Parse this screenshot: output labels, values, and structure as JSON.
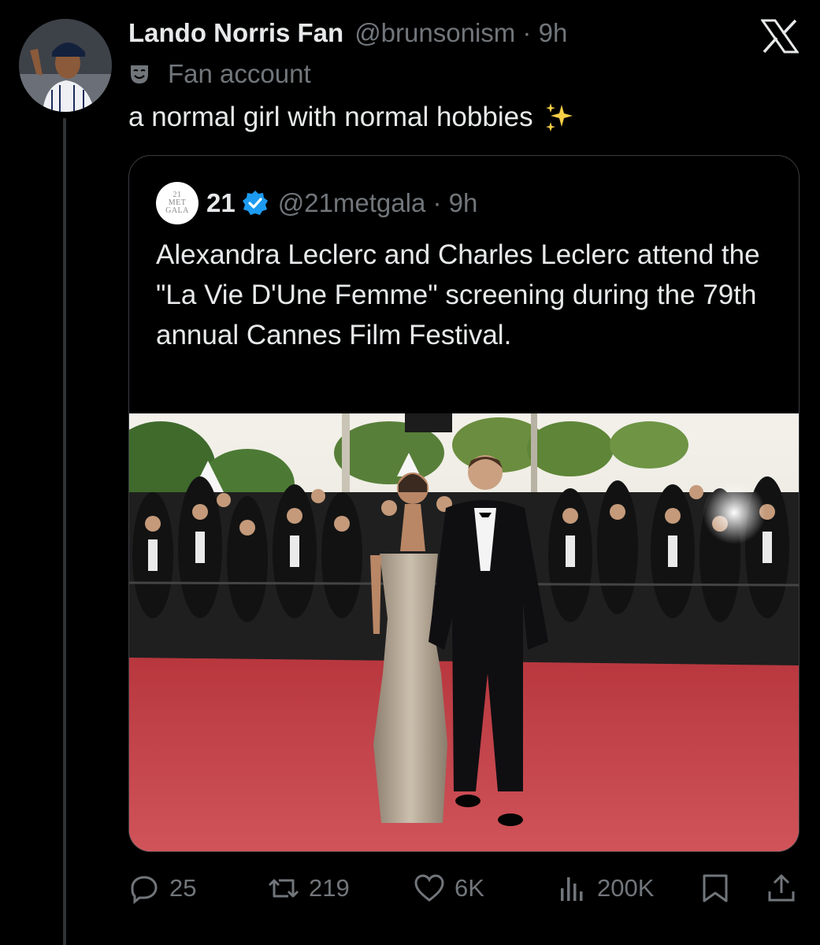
{
  "tweet": {
    "display_name": "Lando Norris Fan",
    "handle": "@brunsonism",
    "time": "9h",
    "label": "Fan account",
    "text": "a normal girl with normal hobbies"
  },
  "quoted": {
    "avatar_lines": [
      "21",
      "MET",
      "GALA"
    ],
    "display_name": "21",
    "handle": "@21metgala",
    "time": "9h",
    "text": "Alexandra Leclerc and Charles Leclerc attend the \"La Vie D'Une Femme\" screening during the 79th annual Cannes Film Festival."
  },
  "actions": {
    "replies": "25",
    "reposts": "219",
    "likes": "6K",
    "views": "200K"
  },
  "colors": {
    "background": "#000000",
    "text_primary": "#e7e9ea",
    "text_secondary": "#71767b",
    "verified": "#1d9bf0",
    "red_carpet": "#c8454c"
  },
  "icons": [
    "x-logo-icon",
    "mask-icon",
    "sparkles-icon",
    "verified-badge-icon",
    "reply-icon",
    "repost-icon",
    "like-icon",
    "views-icon",
    "bookmark-icon",
    "share-icon"
  ]
}
